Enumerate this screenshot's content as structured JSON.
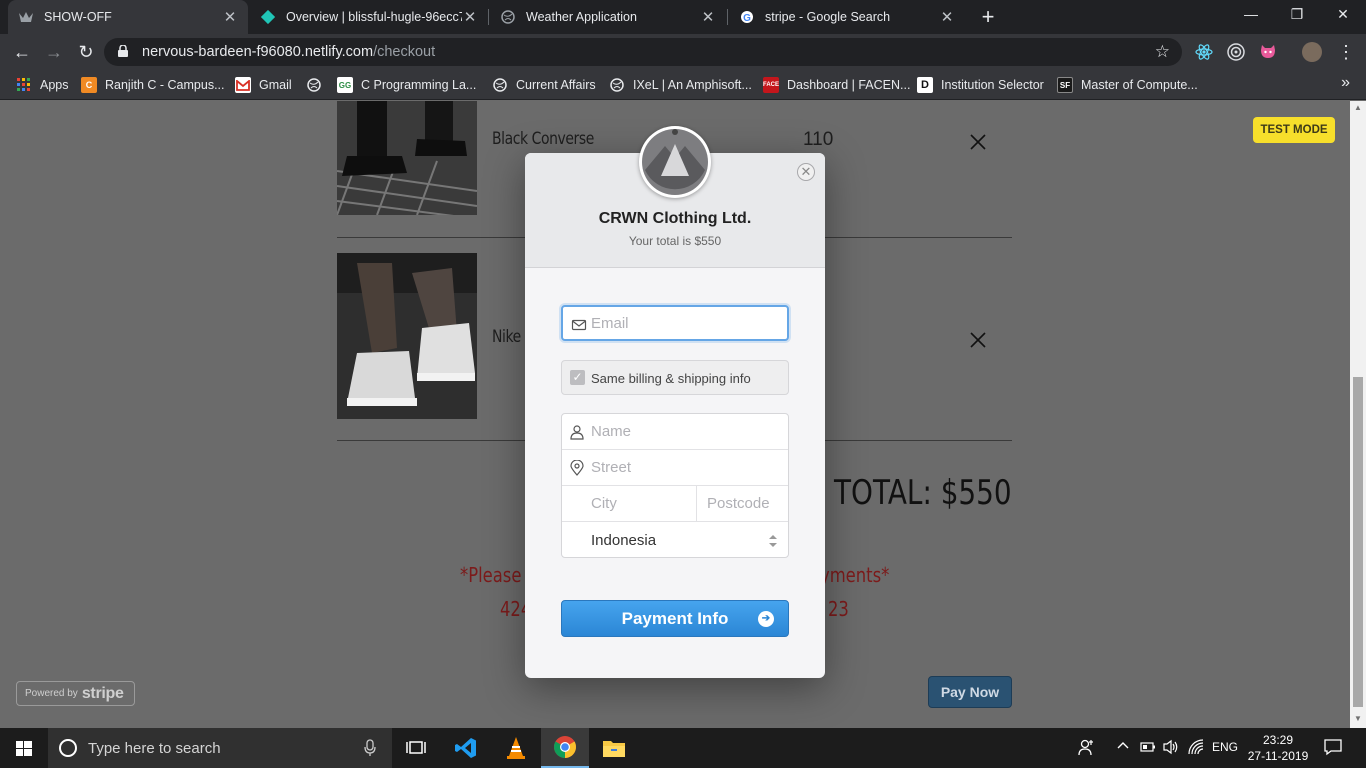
{
  "browser": {
    "tabs": [
      {
        "title": "SHOW-OFF",
        "active": true
      },
      {
        "title": "Overview | blissful-hugle-96ecc7",
        "active": false
      },
      {
        "title": "Weather Application",
        "active": false
      },
      {
        "title": "stripe - Google Search",
        "active": false
      }
    ],
    "url_host": "nervous-bardeen-f96080.netlify.com",
    "url_path": "/checkout",
    "bookmarks": [
      "Apps",
      "Ranjith C - Campus...",
      "Gmail",
      "",
      "C Programming La...",
      "Current Affairs",
      "IXeL | An Amphisoft...",
      "Dashboard | FACEN...",
      "Institution Selector",
      "Master of Compute..."
    ]
  },
  "page": {
    "items": [
      {
        "name": "Black Converse",
        "price": "110"
      },
      {
        "name": "Nike",
        "price": ""
      }
    ],
    "total": "TOTAL: $550",
    "warning_line1_left": "*Please",
    "warning_line1_right": "yments*",
    "warning_line2_left": "424",
    "warning_line2_right": "23",
    "powered_prefix": "Powered by",
    "powered_brand": "stripe",
    "pay_now": "Pay Now",
    "test_mode": "TEST MODE"
  },
  "checkout": {
    "merchant": "CRWN Clothing Ltd.",
    "total_text": "Your total is $550",
    "email_placeholder": "Email",
    "same_billing_label": "Same billing & shipping info",
    "name_placeholder": "Name",
    "street_placeholder": "Street",
    "city_placeholder": "City",
    "postcode_placeholder": "Postcode",
    "country": "Indonesia",
    "submit_label": "Payment Info"
  },
  "taskbar": {
    "search_placeholder": "Type here to search",
    "language": "ENG",
    "time": "23:29",
    "date": "27-11-2019"
  }
}
